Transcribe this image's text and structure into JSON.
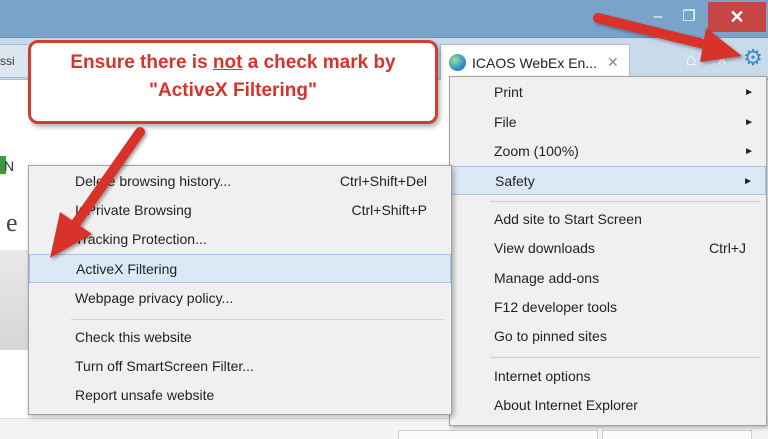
{
  "window": {
    "minimize_glyph": "–",
    "maximize_glyph": "❐",
    "close_glyph": "✕"
  },
  "tabs": {
    "left_fragment": "ssi",
    "active_title": "ICAOS WebEx En...",
    "active_close": "✕"
  },
  "toolbar": {
    "home_icon": "home-icon",
    "star_icon": "star-icon",
    "gear_icon": "gear-icon"
  },
  "page": {
    "fav_fragment": "N",
    "heading_fragment": "e"
  },
  "callout": {
    "line1_before": "Ensure there is ",
    "line1_emphasis": "not",
    "line1_after": " a check mark by",
    "line2": "\"ActiveX Filtering\""
  },
  "tools_menu": {
    "items": [
      {
        "label": "Print",
        "submenu": true
      },
      {
        "label": "File",
        "submenu": true
      },
      {
        "label": "Zoom (100%)",
        "submenu": true
      },
      {
        "label": "Safety",
        "submenu": true,
        "selected": true
      },
      {
        "label": "Add site to Start Screen"
      },
      {
        "label": "View downloads",
        "shortcut": "Ctrl+J"
      },
      {
        "label": "Manage add-ons"
      },
      {
        "label": "F12 developer tools"
      },
      {
        "label": "Go to pinned sites"
      },
      {
        "label": "Internet options"
      },
      {
        "label": "About Internet Explorer"
      }
    ],
    "submenu_arrow": "►"
  },
  "safety_menu": {
    "items": [
      {
        "label": "Delete browsing history...",
        "shortcut": "Ctrl+Shift+Del"
      },
      {
        "label": "InPrivate Browsing",
        "shortcut": "Ctrl+Shift+P"
      },
      {
        "label": "Tracking Protection..."
      },
      {
        "label": "ActiveX Filtering",
        "selected": true
      },
      {
        "label": "Webpage privacy policy..."
      },
      {
        "label": "Check this website"
      },
      {
        "label": "Turn off SmartScreen Filter..."
      },
      {
        "label": "Report unsafe website"
      }
    ]
  },
  "colors": {
    "annotation_red": "#d8332a",
    "titlebar": "#7aa3c9",
    "menu_bg": "#f0f0f0",
    "selection": "#dbe8f6"
  }
}
